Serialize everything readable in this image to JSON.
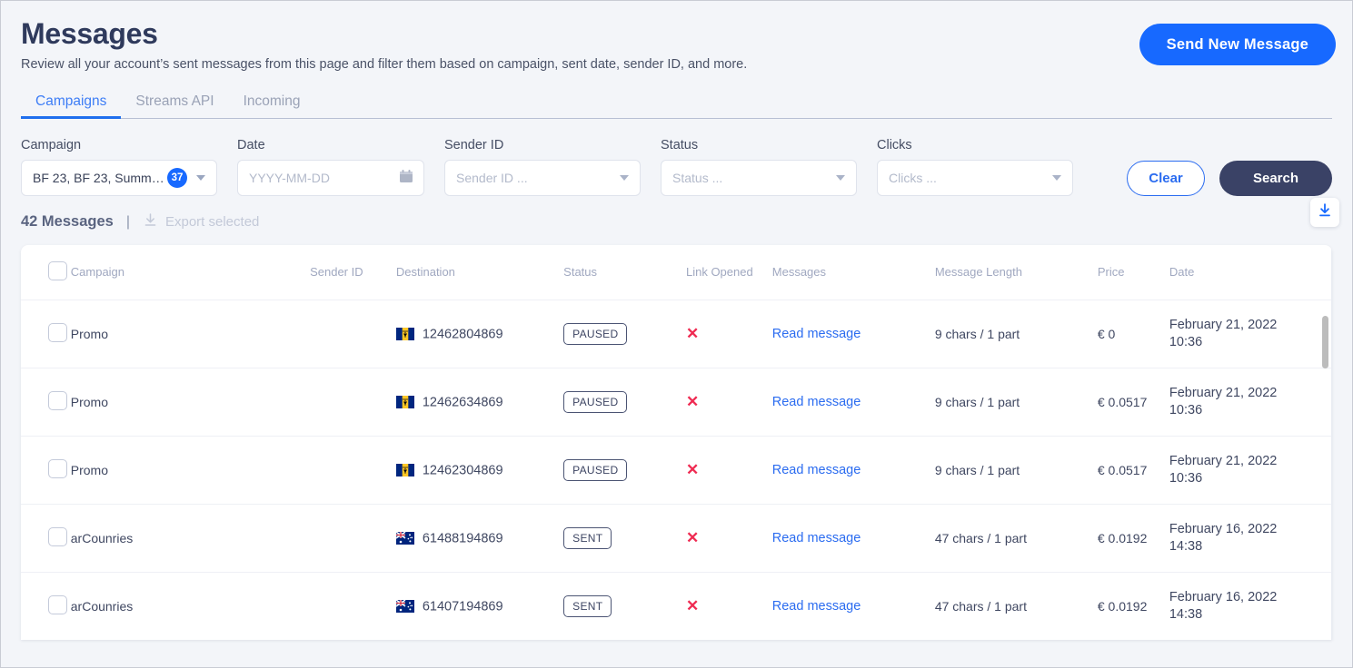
{
  "header": {
    "title": "Messages",
    "subtitle": "Review all your account’s sent messages from this page and filter them based on campaign, sent date, sender ID, and more.",
    "send_button": "Send New Message"
  },
  "tabs": [
    {
      "label": "Campaigns",
      "active": true
    },
    {
      "label": "Streams API",
      "active": false
    },
    {
      "label": "Incoming",
      "active": false
    }
  ],
  "filters": {
    "campaign": {
      "label": "Campaign",
      "value": "BF 23, BF 23, Summ…",
      "badge": "37"
    },
    "date": {
      "label": "Date",
      "placeholder": "YYYY-MM-DD"
    },
    "sender_id": {
      "label": "Sender ID",
      "placeholder": "Sender ID ..."
    },
    "status": {
      "label": "Status",
      "placeholder": "Status ..."
    },
    "clicks": {
      "label": "Clicks",
      "placeholder": "Clicks ..."
    },
    "clear_button": "Clear",
    "search_button": "Search"
  },
  "summary": {
    "count": "42 Messages",
    "separator": "|",
    "export_label": "Export selected"
  },
  "table": {
    "columns": [
      "Campaign",
      "Sender ID",
      "Destination",
      "Status",
      "Link Opened",
      "Messages",
      "Message Length",
      "Price",
      "Date"
    ],
    "rows": [
      {
        "campaign": "Promo",
        "sender_id": "",
        "flag": "barbados-flag",
        "destination": "12462804869",
        "status": "PAUSED",
        "link_opened": "not-opened-icon",
        "message_link": "Read message",
        "message_length": "9 chars / 1 part",
        "price": "€ 0",
        "date_line1": "February 21, 2022",
        "date_line2": "10:36"
      },
      {
        "campaign": "Promo",
        "sender_id": "",
        "flag": "barbados-flag",
        "destination": "12462634869",
        "status": "PAUSED",
        "link_opened": "not-opened-icon",
        "message_link": "Read message",
        "message_length": "9 chars / 1 part",
        "price": "€ 0.0517",
        "date_line1": "February 21, 2022",
        "date_line2": "10:36"
      },
      {
        "campaign": "Promo",
        "sender_id": "",
        "flag": "barbados-flag",
        "destination": "12462304869",
        "status": "PAUSED",
        "link_opened": "not-opened-icon",
        "message_link": "Read message",
        "message_length": "9 chars / 1 part",
        "price": "€ 0.0517",
        "date_line1": "February 21, 2022",
        "date_line2": "10:36"
      },
      {
        "campaign": "arCounries",
        "sender_id": "",
        "flag": "australia-flag",
        "destination": "61488194869",
        "status": "SENT",
        "link_opened": "not-opened-icon",
        "message_link": "Read message",
        "message_length": "47 chars / 1 part",
        "price": "€ 0.0192",
        "date_line1": "February 16, 2022",
        "date_line2": "14:38"
      },
      {
        "campaign": "arCounries",
        "sender_id": "",
        "flag": "australia-flag",
        "destination": "61407194869",
        "status": "SENT",
        "link_opened": "not-opened-icon",
        "message_link": "Read message",
        "message_length": "47 chars / 1 part",
        "price": "€ 0.0192",
        "date_line1": "February 16, 2022",
        "date_line2": "14:38"
      }
    ]
  },
  "colors": {
    "accent_blue": "#1769ff",
    "tab_active": "#3d7df6",
    "dark_navy": "#3a4266",
    "title": "#2f3a5c",
    "danger_red": "#ef2b52",
    "page_bg": "#f3f5f9"
  }
}
